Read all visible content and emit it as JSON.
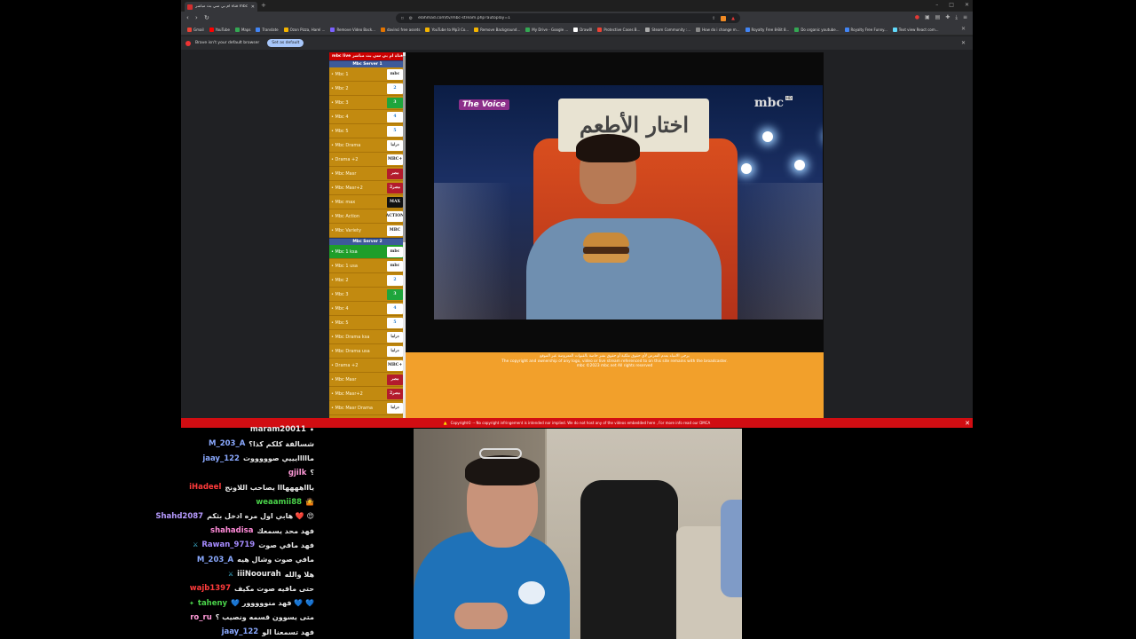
{
  "browser": {
    "tab_title": "قناة ام بي سي بث مباشر mbc",
    "url": "elahmad.com/tv/mbc-stream.php?autoplay=1",
    "bookmarks": [
      {
        "label": "Gmail",
        "color": "#ea4335"
      },
      {
        "label": "YouTube",
        "color": "#ff0000"
      },
      {
        "label": "Maps",
        "color": "#34a853"
      },
      {
        "label": "Translate",
        "color": "#4285f4"
      },
      {
        "label": "Ozon Pizza, Harel ...",
        "color": "#f4b400"
      },
      {
        "label": "Remove Video Back...",
        "color": "#7b61ff"
      },
      {
        "label": "davinci free assets",
        "color": "#e37400"
      },
      {
        "label": "YouTube to Mp3 Co...",
        "color": "#f4b400"
      },
      {
        "label": "Remove Background...",
        "color": "#f4b400"
      },
      {
        "label": "My Drive - Google ...",
        "color": "#34a853"
      },
      {
        "label": "Draw0l",
        "color": "#ffffff"
      },
      {
        "label": "Protective Cases B...",
        "color": "#ea4335"
      },
      {
        "label": "Steam Community :...",
        "color": "#aaaaaa"
      },
      {
        "label": "How do i change m...",
        "color": "#888888"
      },
      {
        "label": "Royalty Free 8-Bit 8...",
        "color": "#4285f4"
      },
      {
        "label": "Do organic youtube...",
        "color": "#34a853"
      },
      {
        "label": "Royalty Free Funny...",
        "color": "#4285f4"
      },
      {
        "label": "Text view React com...",
        "color": "#61dafb"
      }
    ],
    "infobar_text": "Brave isn't your default browser",
    "infobar_button": "Set as default"
  },
  "site": {
    "header_left": "mbc live",
    "header_right": "قناة ام بي سي بث مباشر",
    "servers": [
      {
        "title": "Mbc Server 1",
        "channels": [
          {
            "label": "• Mbc 1",
            "logo": "mbc",
            "style": "plain",
            "active": false
          },
          {
            "label": "• Mbc 2",
            "logo": "2",
            "style": "blue",
            "active": false
          },
          {
            "label": "• Mbc 3",
            "logo": "3",
            "style": "green",
            "active": false
          },
          {
            "label": "• Mbc 4",
            "logo": "4",
            "style": "blue",
            "active": false
          },
          {
            "label": "• Mbc 5",
            "logo": "5",
            "style": "blue",
            "active": false
          },
          {
            "label": "• Mbc Drama",
            "logo": "دراما",
            "style": "plain",
            "active": false
          },
          {
            "label": "• Drama +2",
            "logo": "MBC+",
            "style": "plain",
            "active": false
          },
          {
            "label": "• Mbc Masr",
            "logo": "مصر",
            "style": "red",
            "active": false
          },
          {
            "label": "• Mbc Masr+2",
            "logo": "مصر2",
            "style": "red",
            "active": false
          },
          {
            "label": "• Mbc max",
            "logo": "MAX",
            "style": "dark",
            "active": false
          },
          {
            "label": "• Mbc Action",
            "logo": "ACTION",
            "style": "plain",
            "active": false
          },
          {
            "label": "• Mbc Variety",
            "logo": "MBC",
            "style": "plain",
            "active": false
          }
        ]
      },
      {
        "title": "Mbc Server 2",
        "channels": [
          {
            "label": "• Mbc 1 ksa",
            "logo": "mbc",
            "style": "plain",
            "active": true
          },
          {
            "label": "• Mbc 1 usa",
            "logo": "mbc",
            "style": "plain",
            "active": false
          },
          {
            "label": "• Mbc 2",
            "logo": "2",
            "style": "blue",
            "active": false
          },
          {
            "label": "• Mbc 3",
            "logo": "3",
            "style": "green",
            "active": false
          },
          {
            "label": "• Mbc 4",
            "logo": "4",
            "style": "blue",
            "active": false
          },
          {
            "label": "• Mbc 5",
            "logo": "5",
            "style": "blue",
            "active": false
          },
          {
            "label": "• Mbc Drama ksa",
            "logo": "دراما",
            "style": "plain",
            "active": false
          },
          {
            "label": "• Mbc Drama usa",
            "logo": "دراما",
            "style": "plain",
            "active": false
          },
          {
            "label": "• Drama +2",
            "logo": "MBC+",
            "style": "plain",
            "active": false
          },
          {
            "label": "• Mbc Masr",
            "logo": "مصر",
            "style": "red",
            "active": false
          },
          {
            "label": "• Mbc Masr+2",
            "logo": "مصر2",
            "style": "red",
            "active": false
          },
          {
            "label": "• Mbc Masr Drama",
            "logo": "دراما",
            "style": "plain",
            "active": false
          }
        ]
      }
    ],
    "video": {
      "voice_logo": "The Voice",
      "watermark": "mbc",
      "hd": "HD",
      "chair_text": "اختار الأطعم"
    },
    "disclaimer": [
      "يرجى الانتباه بعدم التعرض لأي حقوق ملكية أو حقوق نشر خاصة بالقنوات المعروضة عبر الموقع",
      "The copyright and ownership of any logo, video or live stream referenced to on this site remains with the broadcaster.",
      "mbc ©2023 mbc.net All rights reserved"
    ],
    "footer": "Copyright© -- No copyright infringement is intended nor implied. We do not host any of the videos embedded here , For more info read our DMCA"
  },
  "chat": [
    {
      "user": "maram20011",
      "text": "•",
      "color": "#e8e8e8",
      "badge": ""
    },
    {
      "user": "M_203_A",
      "text": "شسالفة كلكم كذا؟",
      "color": "#8aa9ff",
      "badge": ""
    },
    {
      "user": "jaay_122",
      "text": "مااااايييي صوووووت",
      "color": "#8aa9ff",
      "badge": ""
    },
    {
      "user": "gjilk",
      "text": "؟",
      "color": "#ff9ad8",
      "badge": ""
    },
    {
      "user": "iHadeel",
      "text": "ياااههههااا يصاحب اللاونج",
      "color": "#ff3b3b",
      "badge": ""
    },
    {
      "user": "weaamii88",
      "text": "🤷",
      "color": "#4ad34a",
      "badge": ""
    },
    {
      "user": "Shahd2087",
      "text": "😍 ❤️ هابي اول مره ادخل بثكم",
      "color": "#b79bff",
      "badge": ""
    },
    {
      "user": "shahadisa",
      "text": "فهد محد يسمعك",
      "color": "#ff8ad8",
      "badge": ""
    },
    {
      "user": "Rawan_9719",
      "text": "فهد مافي صوت",
      "color": "#a68bff",
      "badge": "mod"
    },
    {
      "user": "M_203_A",
      "text": "مافي صوت وشال هيه",
      "color": "#8aa9ff",
      "badge": ""
    },
    {
      "user": "iiiNoourah",
      "text": "هلا والله",
      "color": "#e8e8e8",
      "badge": "mod"
    },
    {
      "user": "wajb1397",
      "text": "حتى مافيه صوت مكيف",
      "color": "#ff3b3b",
      "badge": ""
    },
    {
      "user": "taheny",
      "text": "💙 💙 فهد منووووور 💙",
      "color": "#4ad34a",
      "badge": "star"
    },
    {
      "user": "ro_ru",
      "text": "متى يسوون قسمه ونصيب ؟",
      "color": "#ff9ad8",
      "badge": ""
    },
    {
      "user": "jaay_122",
      "text": "فهد تسمعنا الو",
      "color": "#8aa9ff",
      "badge": ""
    }
  ]
}
